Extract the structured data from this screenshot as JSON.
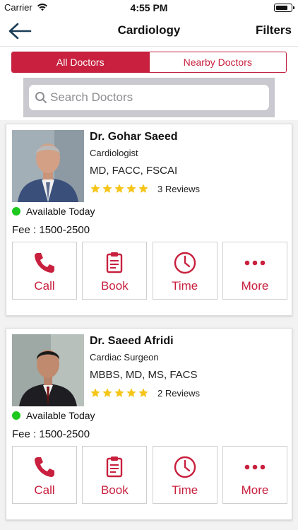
{
  "status_bar": {
    "carrier": "Carrier",
    "time": "4:55 PM"
  },
  "nav": {
    "title": "Cardiology",
    "filters_label": "Filters",
    "back_icon": "back-arrow-icon"
  },
  "segments": {
    "all": "All Doctors",
    "nearby": "Nearby Doctors",
    "selected": "All Doctors"
  },
  "search": {
    "placeholder": "Search Doctors"
  },
  "colors": {
    "accent": "#c8203e",
    "available": "#1ec81e",
    "star": "#f5c518"
  },
  "doctors": [
    {
      "name": "Dr. Gohar Saeed",
      "specialty": "Cardiologist",
      "qualifications": "MD, FACC, FSCAI",
      "rating": 5,
      "reviews": "3 Reviews",
      "availability": "Available Today",
      "fee": "Fee : 1500-2500",
      "actions": {
        "call": "Call",
        "book": "Book",
        "time": "Time",
        "more": "More"
      }
    },
    {
      "name": "Dr. Saeed Afridi",
      "specialty": "Cardiac Surgeon",
      "qualifications": "MBBS, MD, MS, FACS",
      "rating": 5,
      "reviews": "2 Reviews",
      "availability": "Available Today",
      "fee": "Fee : 1500-2500",
      "actions": {
        "call": "Call",
        "book": "Book",
        "time": "Time",
        "more": "More"
      }
    }
  ]
}
